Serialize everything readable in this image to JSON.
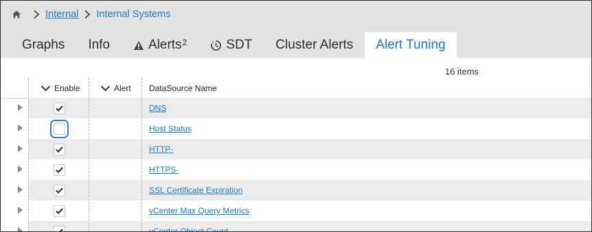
{
  "breadcrumb": {
    "home_icon": "home-icon",
    "items": [
      "Internal",
      "Internal Systems"
    ]
  },
  "tabs": [
    {
      "label": "Graphs",
      "icon": null,
      "badge": null,
      "active": false
    },
    {
      "label": "Info",
      "icon": null,
      "badge": null,
      "active": false
    },
    {
      "label": "Alerts",
      "icon": "warning-icon",
      "badge": "2",
      "active": false
    },
    {
      "label": "SDT",
      "icon": "sdt-clock-icon",
      "badge": null,
      "active": false
    },
    {
      "label": "Cluster Alerts",
      "icon": null,
      "badge": null,
      "active": false
    },
    {
      "label": "Alert Tuning",
      "icon": null,
      "badge": null,
      "active": true
    }
  ],
  "item_count": "16 items",
  "table": {
    "columns": [
      "Enable",
      "Alert",
      "DataSource Name"
    ],
    "rows": [
      {
        "enabled": true,
        "name": "DNS"
      },
      {
        "enabled": false,
        "name": "Host Status",
        "focused": true
      },
      {
        "enabled": true,
        "name": "HTTP-"
      },
      {
        "enabled": true,
        "name": "HTTPS-"
      },
      {
        "enabled": true,
        "name": "SSL Certificate Expiration"
      },
      {
        "enabled": true,
        "name": "vCenter Max Query Metrics"
      },
      {
        "enabled": true,
        "name": "vCenter Object Count"
      }
    ]
  },
  "colors": {
    "link": "#1e78c8",
    "header_bg": "#e3e3e3",
    "row_alt": "#ececec",
    "focus": "#2f7fd0"
  }
}
